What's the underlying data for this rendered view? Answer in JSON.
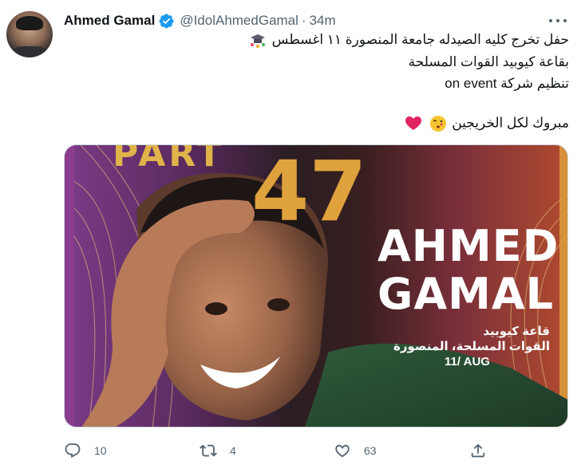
{
  "author": {
    "name": "Ahmed Gamal",
    "handle": "@IdolAhmedGamal",
    "separator": "·",
    "time": "34m"
  },
  "tweet": {
    "line1": "حفل تخرج كليه الصيدله جامعة المنصورة ١١ اغسطس",
    "line2": "بقاعة كيوبيد القوات المسلحة",
    "line3": "تنظيم شركة on event",
    "line4": "مبروك لكل الخريجين"
  },
  "poster": {
    "part": "PART",
    "number": "47",
    "name_line1": "AHMED",
    "name_line2": "GAMAL",
    "venue_line1": "قاعة كيوبيد",
    "venue_line2": "القوات المسلحة، المنصورة",
    "date": "11/ AUG"
  },
  "actions": {
    "reply_count": "10",
    "retweet_count": "4",
    "like_count": "63",
    "share_count": ""
  },
  "icons": {
    "verified": "verified-badge-icon",
    "more": "more-options-icon",
    "reply": "reply-icon",
    "retweet": "retweet-icon",
    "like": "heart-icon",
    "share": "share-icon"
  },
  "colors": {
    "verified": "#1d9bf0",
    "secondary_text": "#536471",
    "primary_text": "#0f1419"
  }
}
